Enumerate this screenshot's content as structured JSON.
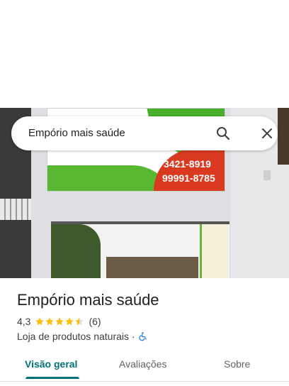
{
  "search": {
    "query": "Empório mais saúde"
  },
  "place": {
    "name": "Empório mais saúde",
    "rating": "4,3",
    "rating_value": 4.3,
    "review_count": "(6)",
    "category": "Loja de produtos naturais",
    "separator": "·"
  },
  "photo": {
    "sign_phone_1": "3421-8919",
    "sign_phone_2": "99991-8785"
  },
  "tabs": [
    {
      "label": "Visão geral",
      "active": true
    },
    {
      "label": "Avaliações",
      "active": false
    },
    {
      "label": "Sobre",
      "active": false
    }
  ],
  "colors": {
    "accent": "#00737a",
    "star": "#fbbc04",
    "accessibility": "#1a73e8"
  },
  "icons": [
    "search-icon",
    "close-icon",
    "star-icon",
    "wheelchair-icon"
  ]
}
